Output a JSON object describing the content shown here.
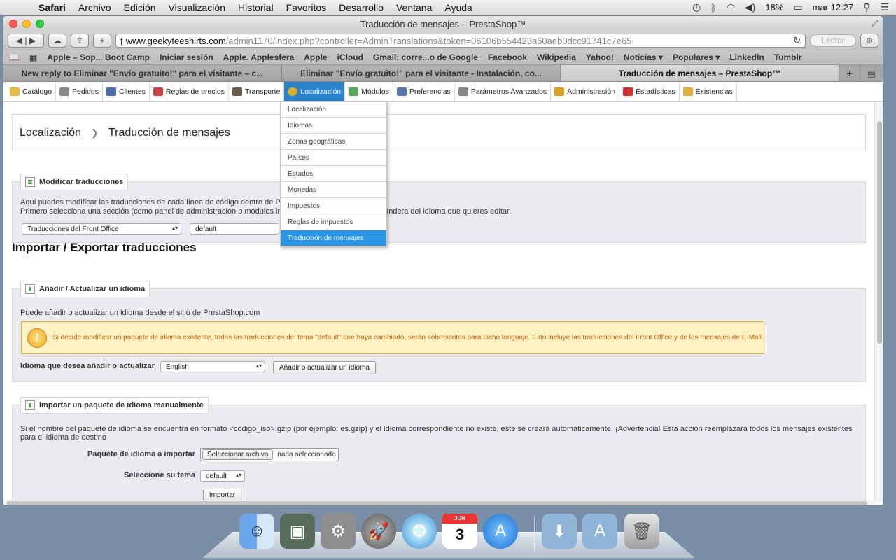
{
  "menubar": {
    "app": "Safari",
    "items": [
      "Archivo",
      "Edición",
      "Visualización",
      "Historial",
      "Favoritos",
      "Desarrollo",
      "Ventana",
      "Ayuda"
    ],
    "battery": "18%",
    "clock": "mar 12:27"
  },
  "window": {
    "title": "Traducción de mensajes – PrestaShop™",
    "url_host": "www.geekyteeshirts.com",
    "url_path": "/admin1170/index.php?controller=AdminTranslations&token=06106b554423a60aeb0dcc91741c7e65",
    "reader_label": "Lector"
  },
  "bookmarks": [
    "Apple – Sop... Boot Camp",
    "Iniciar sesión",
    "Apple. Applesfera",
    "Apple",
    "iCloud",
    "Gmail: corre...o de Google",
    "Facebook",
    "Wikipedia",
    "Yahoo!",
    "Noticias ▾",
    "Populares ▾",
    "LinkedIn",
    "Tumblr"
  ],
  "tabs": [
    {
      "title": "New reply to Eliminar \"Envío gratuito!\" para el visitante – c..."
    },
    {
      "title": "Eliminar \"Envío gratuito!\" para el visitante - Instalación, co..."
    },
    {
      "title": "Traducción de mensajes – PrestaShop™"
    }
  ],
  "ps_menu": [
    {
      "label": "Catálogo",
      "icon": "folder-icon",
      "color": "#e8b84a"
    },
    {
      "label": "Pedidos",
      "icon": "cart-icon",
      "color": "#8a8a8a"
    },
    {
      "label": "Clientes",
      "icon": "user-icon",
      "color": "#4a6fa5"
    },
    {
      "label": "Reglas de precios",
      "icon": "pricetag-icon",
      "color": "#c44"
    },
    {
      "label": "Transporte",
      "icon": "truck-icon",
      "color": "#6b5b4b"
    },
    {
      "label": "Localización",
      "icon": "globe-icon",
      "color": "#d8b030"
    },
    {
      "label": "Módulos",
      "icon": "puzzle-icon",
      "color": "#5a5"
    },
    {
      "label": "Preferencias",
      "icon": "preferences-icon",
      "color": "#57a"
    },
    {
      "label": "Parámetros Avanzados",
      "icon": "wrench-icon",
      "color": "#888"
    },
    {
      "label": "Administración",
      "icon": "key-icon",
      "color": "#d6a020"
    },
    {
      "label": "Estadísticas",
      "icon": "chart-icon",
      "color": "#c33"
    },
    {
      "label": "Existencias",
      "icon": "box-icon",
      "color": "#e0b040"
    }
  ],
  "dropdown": [
    "Localización",
    "Idiomas",
    "Zonas geográficas",
    "Países",
    "Estados",
    "Monedas",
    "Impuestos",
    "Reglas de impuestos",
    "Traducción de mensajes"
  ],
  "breadcrumb": {
    "parent": "Localización",
    "current": "Traducción de mensajes"
  },
  "modify": {
    "legend": "Modificar traducciones",
    "line1": "Aquí puedes modificar las traducciones de cada línea de código dentro de P",
    "line2": "Primero selecciona una sección (como panel de administración o módulos in",
    "line2_end": "bandera del idioma que quieres editar.",
    "select_type": "Traducciones del Front Office",
    "select_theme": "default"
  },
  "import_export_title": "Importar / Exportar traducciones",
  "add_update": {
    "legend": "Añadir / Actualizar un idioma",
    "intro": "Puede añadir o actualizar un idioma desde el sitio de PrestaShop.com",
    "warning": "Si decide modificar un paquete de idioma existente, todas las traducciones del tema \"default\" que haya cambiado, serán sobrescritas para dicho lenguaje. Esto incluye las traducciones del Front Office y de los mensajes de E-Mail.",
    "label": "Idioma que desea añadir o actualizar",
    "language": "English",
    "button": "Añadir o actualizar un idioma"
  },
  "manual_import": {
    "legend": "Importar un paquete de idioma manualmente",
    "desc1": "Si el nombre del paquete de idioma se encuentra en formato <código_iso>.gzip (por ejemplo: es.gzip) y el idioma correspondiente no existe, este se creará automáticamente. ¡Advertencia! Esta acción reemplazará todos los mensajes existentes",
    "desc2": "para el idioma de destino",
    "package_label": "Paquete de idioma a importar",
    "file_button": "Seleccionar archivo",
    "file_status": "nada seleccionado",
    "theme_label": "Seleccione su tema",
    "theme_value": "default",
    "import_button": "Importar"
  },
  "dock": {
    "items": [
      "finder-icon",
      "photo-icon",
      "system-preferences-icon",
      "launchpad-icon",
      "safari-icon",
      "calendar-icon",
      "app-store-icon",
      "downloads-folder-icon",
      "applications-folder-icon",
      "trash-icon"
    ],
    "calendar_month": "JUN",
    "calendar_day": "3"
  }
}
